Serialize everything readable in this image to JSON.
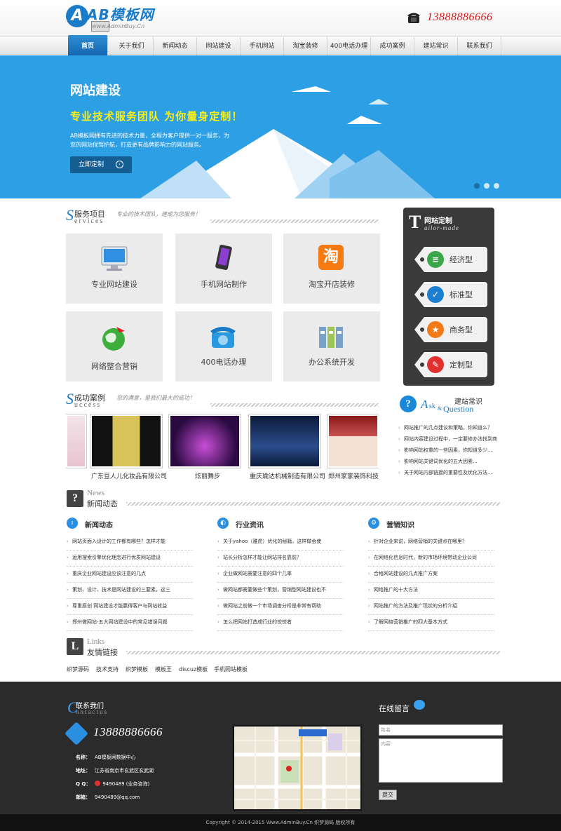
{
  "header": {
    "logo_text": "AB模板网",
    "logo_letter": "A",
    "logo_sub": "www.AdminBuy.Cn",
    "phone": "13888886666"
  },
  "nav": [
    "首页",
    "关于我们",
    "新闻动态",
    "网站建设",
    "手机网站",
    "淘宝装修",
    "400电话办理",
    "成功案例",
    "建站常识",
    "联系我们"
  ],
  "banner": {
    "title": "网站建设",
    "slogan": "专业技术服务团队  为你量身定制！",
    "text": "AB模板网拥有先进的技术力量，全程为客户提供一对一服务，为您的网站保驾护航，打造更有品牌影响力的网站服务。",
    "button": "立即定制",
    "button_icon": "›"
  },
  "services": {
    "cn": "服务项目",
    "big": "S",
    "en": "ervices",
    "desc": "专业的技术团队，建成为您服务！",
    "items": [
      {
        "label": "专业网站建设",
        "icon": "monitor-icon"
      },
      {
        "label": "手机网站制作",
        "icon": "phone-icon"
      },
      {
        "label": "淘宝开店装修",
        "icon": "taobao-icon",
        "glyph": "淘"
      },
      {
        "label": "网络整合营销",
        "icon": "globe-icon"
      },
      {
        "label": "400电话办理",
        "icon": "telephone-icon"
      },
      {
        "label": "办公系统开发",
        "icon": "office-icon"
      }
    ]
  },
  "tailor": {
    "big": "T",
    "cn": "网站定制",
    "en": "ailor-made",
    "tags": [
      {
        "label": "经济型",
        "color": "#3aa84a",
        "glyph": "≡"
      },
      {
        "label": "标准型",
        "color": "#1e7fd0",
        "glyph": "✓"
      },
      {
        "label": "商务型",
        "color": "#f07a1a",
        "glyph": "★"
      },
      {
        "label": "定制型",
        "color": "#e03030",
        "glyph": "✎"
      }
    ]
  },
  "cases": {
    "cn": "成功案例",
    "big": "S",
    "en": "uccess",
    "desc": "您的满意，是我们最大的成功！",
    "items": [
      "广东豆人儿化妆品有限公司",
      "炫丽舞步",
      "重庆瑜达机械制造有限公司",
      "郑州家家装饰科技"
    ]
  },
  "ask": {
    "big": "A",
    "en1": "sk",
    "en2": "&",
    "en3": "Question",
    "cn": "建站常识",
    "items": [
      "网站推广的几点建议和策略，你知道么？",
      "网站内容建设过程中，一定要修办法找到商",
      "影响网站权重的一些因素，你知道多少...",
      "影响网站关键词优化的五大因素...",
      "关于网站内部链接的重要性及优化方法..."
    ]
  },
  "news": {
    "en": "News",
    "cn": "新闻动态",
    "cols": [
      {
        "title": "新闻动态",
        "color": "#2a8fe0",
        "glyph": "i",
        "items": [
          "网站页面入设计的工作都有哪些？怎样才能",
          "运用搜索引擎优化理念进行优质网站建设",
          "重庆企业网站建设应该注意的几点",
          "策划、设计、技术是网站建设的三要素，这三",
          "尊重原创 网站建设才能赢得客户与网站收益",
          "郑州做网站-五大网站建设中的常见错误问题"
        ]
      },
      {
        "title": "行业资讯",
        "color": "#2a8fe0",
        "glyph": "◐",
        "items": [
          "关于yahoo（雅虎）优化的秘籍，这样做会使",
          "站长分析怎样才能让网站排名靠前？",
          "企业做网站需要注意的四个几率",
          "做网站都需要做些个策划，营销型网站建设也不",
          "做网站之前做一个市场调查分析是非常有帮助",
          "怎么把网站打造成行业的佼佼者"
        ]
      },
      {
        "title": "营销知识",
        "color": "#2a8fe0",
        "glyph": "⚙",
        "items": [
          "针对企业来说，网络营销的关键点在哪里？",
          "在网络化信息时代，新的市场环境带动企业公司",
          "合格网站建设的几点推广方案",
          "网络推广的十大方法",
          "网站推广的方法及推广现状的分析介绍",
          "了解网络营销推广的四大基本方式"
        ]
      }
    ]
  },
  "links": {
    "en": "Links",
    "cn": "友情链接",
    "items": [
      "织梦源码",
      "技术支持",
      "织梦模板",
      "模板王",
      "discuz模板",
      "手机网站模板"
    ]
  },
  "footer": {
    "cn": "联系我们",
    "big": "C",
    "en": "ontactus",
    "phone": "13888886666",
    "name_label": "名称：",
    "name": "AB模板网数据中心",
    "addr_label": "地址：",
    "addr": "江苏省南京市玄武区玄武湖",
    "qq_label": "Q Q：",
    "qq": "9490489 (业务咨询)",
    "email_label": "邮箱：",
    "email": "9490489@qq.com",
    "msg_title": "在线留言",
    "name_placeholder": "姓名",
    "content_placeholder": "内容",
    "submit": "提交",
    "copyright": "Copyright © 2014-2015 Www.AdminBuy.Cn 织梦源码 版权所有"
  }
}
